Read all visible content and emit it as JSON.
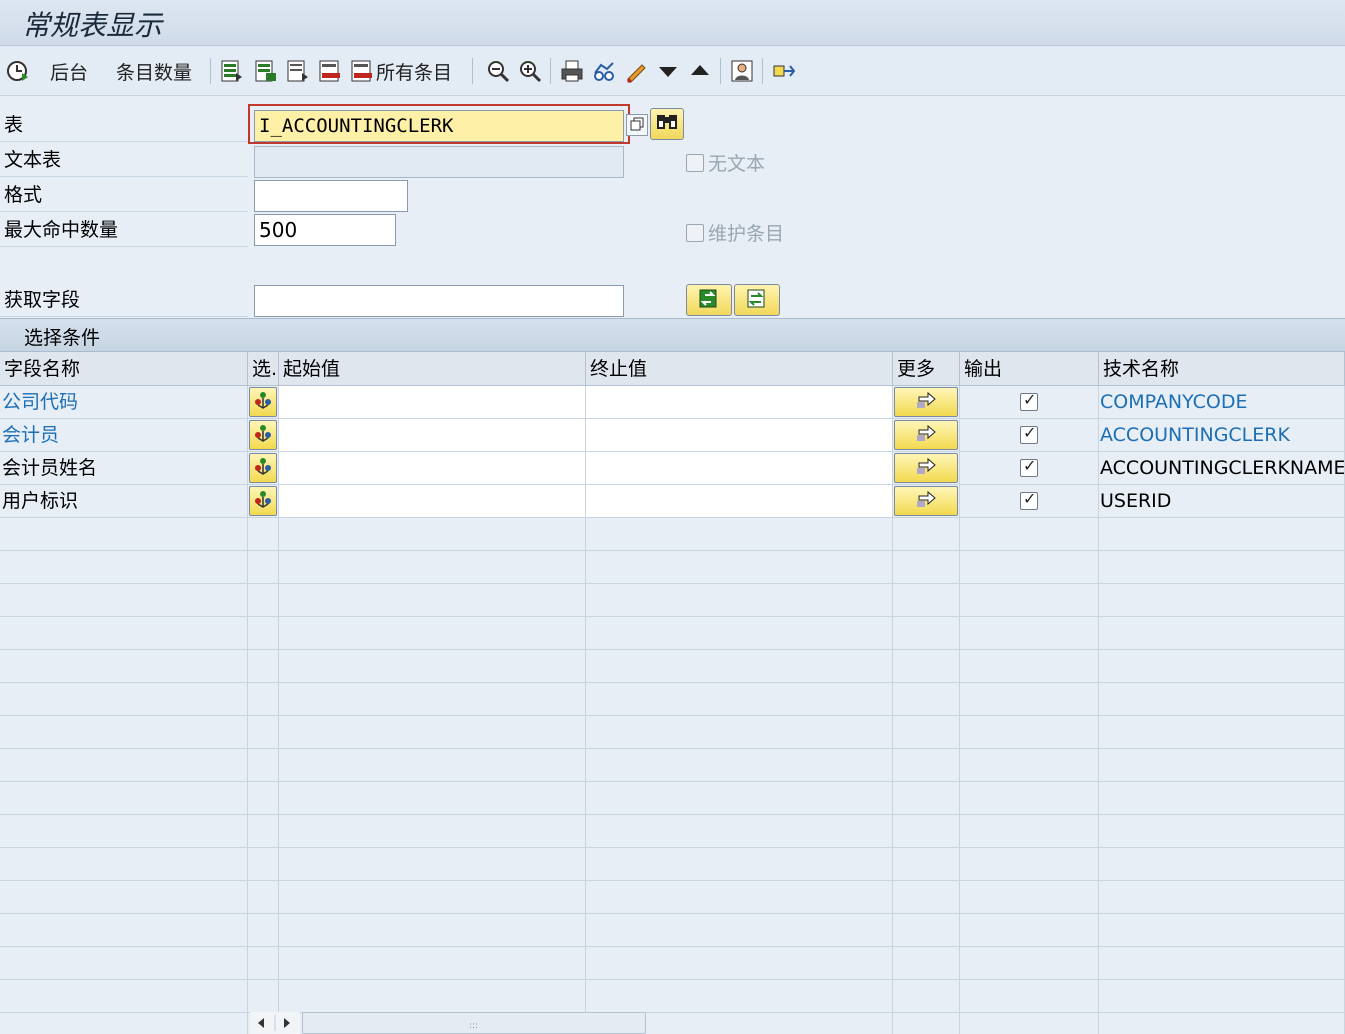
{
  "window": {
    "title": "常规表显示"
  },
  "toolbar": {
    "background_label": "后台",
    "entry_count_label": "条目数量",
    "all_entries_label": "所有条目"
  },
  "form": {
    "table_label": "表",
    "table_value": "I_ACCOUNTINGCLERK",
    "text_table_label": "文本表",
    "text_table_value": "",
    "layout_label": "格式",
    "layout_value": "",
    "max_hits_label": "最大命中数量",
    "max_hits_value": "500",
    "get_fields_label": "获取字段",
    "get_fields_value": "",
    "no_text_label": "无文本",
    "maintain_entries_label": "维护条目"
  },
  "selection": {
    "section_title": "选择条件",
    "columns": [
      "字段名称",
      "选.",
      "起始值",
      "终止值",
      "更多",
      "输出",
      "技术名称"
    ],
    "rows": [
      {
        "field": "公司代码",
        "from": "",
        "to": "",
        "output": true,
        "tech": "COMPANYCODE",
        "key": true
      },
      {
        "field": "会计员",
        "from": "",
        "to": "",
        "output": true,
        "tech": "ACCOUNTINGCLERK",
        "key": true
      },
      {
        "field": "会计员姓名",
        "from": "",
        "to": "",
        "output": true,
        "tech": "ACCOUNTINGCLERKNAME",
        "key": false
      },
      {
        "field": "用户标识",
        "from": "",
        "to": "",
        "output": true,
        "tech": "USERID",
        "key": false
      }
    ]
  },
  "colors": {
    "link": "#1c6fb5",
    "focus": "#fff0a8",
    "button": "#f2d94f"
  }
}
